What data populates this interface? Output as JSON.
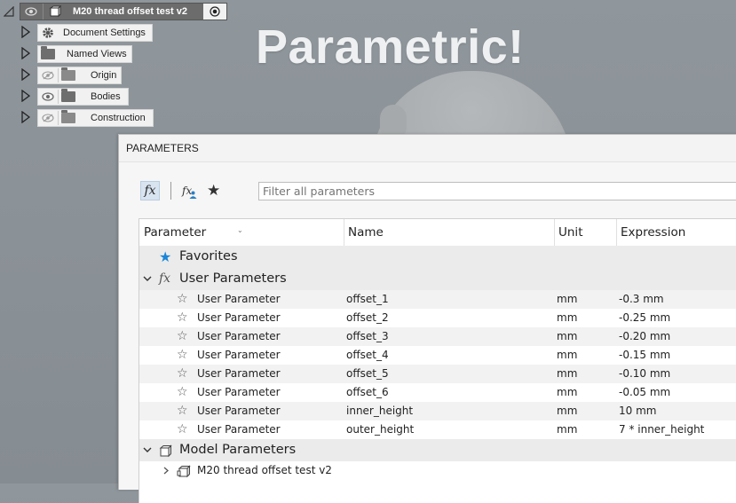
{
  "banner": "Parametric!",
  "browser": {
    "root": {
      "label": "M20 thread offset test v2"
    },
    "items": [
      {
        "label": "Document Settings",
        "icon": "gear-icon",
        "visibility": false
      },
      {
        "label": "Named Views",
        "icon": "folder-icon",
        "visibility": false
      },
      {
        "label": "Origin",
        "icon": "folder-icon",
        "visibility": "hidden"
      },
      {
        "label": "Bodies",
        "icon": "folder-icon",
        "visibility": "visible"
      },
      {
        "label": "Construction",
        "icon": "folder-icon",
        "visibility": "hidden"
      }
    ]
  },
  "dialog": {
    "title": "PARAMETERS",
    "toolbar": {
      "fx_label": "fx",
      "user_fx_label": "fx",
      "favorites_label": "★"
    },
    "search": {
      "placeholder": "Filter all parameters"
    },
    "columns": {
      "parameter": "Parameter",
      "name": "Name",
      "unit": "Unit",
      "expression": "Expression"
    },
    "groups": {
      "favorites": "Favorites",
      "user": "User Parameters",
      "model": "Model Parameters"
    },
    "user_parameters": [
      {
        "parameter": "User Parameter",
        "name": "offset_1",
        "unit": "mm",
        "expression": "-0.3 mm"
      },
      {
        "parameter": "User Parameter",
        "name": "offset_2",
        "unit": "mm",
        "expression": "-0.25 mm"
      },
      {
        "parameter": "User Parameter",
        "name": "offset_3",
        "unit": "mm",
        "expression": "-0.20 mm"
      },
      {
        "parameter": "User Parameter",
        "name": "offset_4",
        "unit": "mm",
        "expression": "-0.15 mm"
      },
      {
        "parameter": "User Parameter",
        "name": "offset_5",
        "unit": "mm",
        "expression": "-0.10 mm"
      },
      {
        "parameter": "User Parameter",
        "name": "offset_6",
        "unit": "mm",
        "expression": "-0.05 mm"
      },
      {
        "parameter": "User Parameter",
        "name": "inner_height",
        "unit": "mm",
        "expression": "10 mm"
      },
      {
        "parameter": "User Parameter",
        "name": "outer_height",
        "unit": "mm",
        "expression": "7 * inner_height"
      }
    ],
    "model_component": "M20 thread offset test v2"
  }
}
